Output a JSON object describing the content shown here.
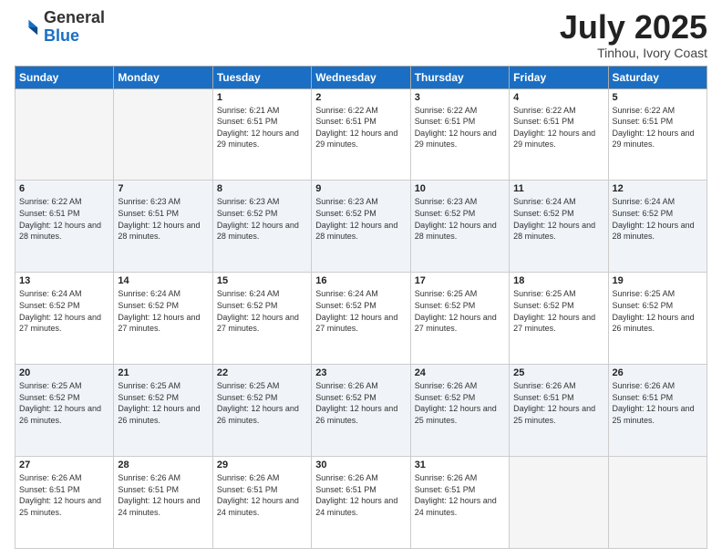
{
  "header": {
    "logo_general": "General",
    "logo_blue": "Blue",
    "main_title": "July 2025",
    "subtitle": "Tinhou, Ivory Coast"
  },
  "days_of_week": [
    "Sunday",
    "Monday",
    "Tuesday",
    "Wednesday",
    "Thursday",
    "Friday",
    "Saturday"
  ],
  "weeks": [
    [
      {
        "day": "",
        "info": ""
      },
      {
        "day": "",
        "info": ""
      },
      {
        "day": "1",
        "info": "Sunrise: 6:21 AM\nSunset: 6:51 PM\nDaylight: 12 hours and 29 minutes."
      },
      {
        "day": "2",
        "info": "Sunrise: 6:22 AM\nSunset: 6:51 PM\nDaylight: 12 hours and 29 minutes."
      },
      {
        "day": "3",
        "info": "Sunrise: 6:22 AM\nSunset: 6:51 PM\nDaylight: 12 hours and 29 minutes."
      },
      {
        "day": "4",
        "info": "Sunrise: 6:22 AM\nSunset: 6:51 PM\nDaylight: 12 hours and 29 minutes."
      },
      {
        "day": "5",
        "info": "Sunrise: 6:22 AM\nSunset: 6:51 PM\nDaylight: 12 hours and 29 minutes."
      }
    ],
    [
      {
        "day": "6",
        "info": "Sunrise: 6:22 AM\nSunset: 6:51 PM\nDaylight: 12 hours and 28 minutes."
      },
      {
        "day": "7",
        "info": "Sunrise: 6:23 AM\nSunset: 6:51 PM\nDaylight: 12 hours and 28 minutes."
      },
      {
        "day": "8",
        "info": "Sunrise: 6:23 AM\nSunset: 6:52 PM\nDaylight: 12 hours and 28 minutes."
      },
      {
        "day": "9",
        "info": "Sunrise: 6:23 AM\nSunset: 6:52 PM\nDaylight: 12 hours and 28 minutes."
      },
      {
        "day": "10",
        "info": "Sunrise: 6:23 AM\nSunset: 6:52 PM\nDaylight: 12 hours and 28 minutes."
      },
      {
        "day": "11",
        "info": "Sunrise: 6:24 AM\nSunset: 6:52 PM\nDaylight: 12 hours and 28 minutes."
      },
      {
        "day": "12",
        "info": "Sunrise: 6:24 AM\nSunset: 6:52 PM\nDaylight: 12 hours and 28 minutes."
      }
    ],
    [
      {
        "day": "13",
        "info": "Sunrise: 6:24 AM\nSunset: 6:52 PM\nDaylight: 12 hours and 27 minutes."
      },
      {
        "day": "14",
        "info": "Sunrise: 6:24 AM\nSunset: 6:52 PM\nDaylight: 12 hours and 27 minutes."
      },
      {
        "day": "15",
        "info": "Sunrise: 6:24 AM\nSunset: 6:52 PM\nDaylight: 12 hours and 27 minutes."
      },
      {
        "day": "16",
        "info": "Sunrise: 6:24 AM\nSunset: 6:52 PM\nDaylight: 12 hours and 27 minutes."
      },
      {
        "day": "17",
        "info": "Sunrise: 6:25 AM\nSunset: 6:52 PM\nDaylight: 12 hours and 27 minutes."
      },
      {
        "day": "18",
        "info": "Sunrise: 6:25 AM\nSunset: 6:52 PM\nDaylight: 12 hours and 27 minutes."
      },
      {
        "day": "19",
        "info": "Sunrise: 6:25 AM\nSunset: 6:52 PM\nDaylight: 12 hours and 26 minutes."
      }
    ],
    [
      {
        "day": "20",
        "info": "Sunrise: 6:25 AM\nSunset: 6:52 PM\nDaylight: 12 hours and 26 minutes."
      },
      {
        "day": "21",
        "info": "Sunrise: 6:25 AM\nSunset: 6:52 PM\nDaylight: 12 hours and 26 minutes."
      },
      {
        "day": "22",
        "info": "Sunrise: 6:25 AM\nSunset: 6:52 PM\nDaylight: 12 hours and 26 minutes."
      },
      {
        "day": "23",
        "info": "Sunrise: 6:26 AM\nSunset: 6:52 PM\nDaylight: 12 hours and 26 minutes."
      },
      {
        "day": "24",
        "info": "Sunrise: 6:26 AM\nSunset: 6:52 PM\nDaylight: 12 hours and 25 minutes."
      },
      {
        "day": "25",
        "info": "Sunrise: 6:26 AM\nSunset: 6:51 PM\nDaylight: 12 hours and 25 minutes."
      },
      {
        "day": "26",
        "info": "Sunrise: 6:26 AM\nSunset: 6:51 PM\nDaylight: 12 hours and 25 minutes."
      }
    ],
    [
      {
        "day": "27",
        "info": "Sunrise: 6:26 AM\nSunset: 6:51 PM\nDaylight: 12 hours and 25 minutes."
      },
      {
        "day": "28",
        "info": "Sunrise: 6:26 AM\nSunset: 6:51 PM\nDaylight: 12 hours and 24 minutes."
      },
      {
        "day": "29",
        "info": "Sunrise: 6:26 AM\nSunset: 6:51 PM\nDaylight: 12 hours and 24 minutes."
      },
      {
        "day": "30",
        "info": "Sunrise: 6:26 AM\nSunset: 6:51 PM\nDaylight: 12 hours and 24 minutes."
      },
      {
        "day": "31",
        "info": "Sunrise: 6:26 AM\nSunset: 6:51 PM\nDaylight: 12 hours and 24 minutes."
      },
      {
        "day": "",
        "info": ""
      },
      {
        "day": "",
        "info": ""
      }
    ]
  ]
}
